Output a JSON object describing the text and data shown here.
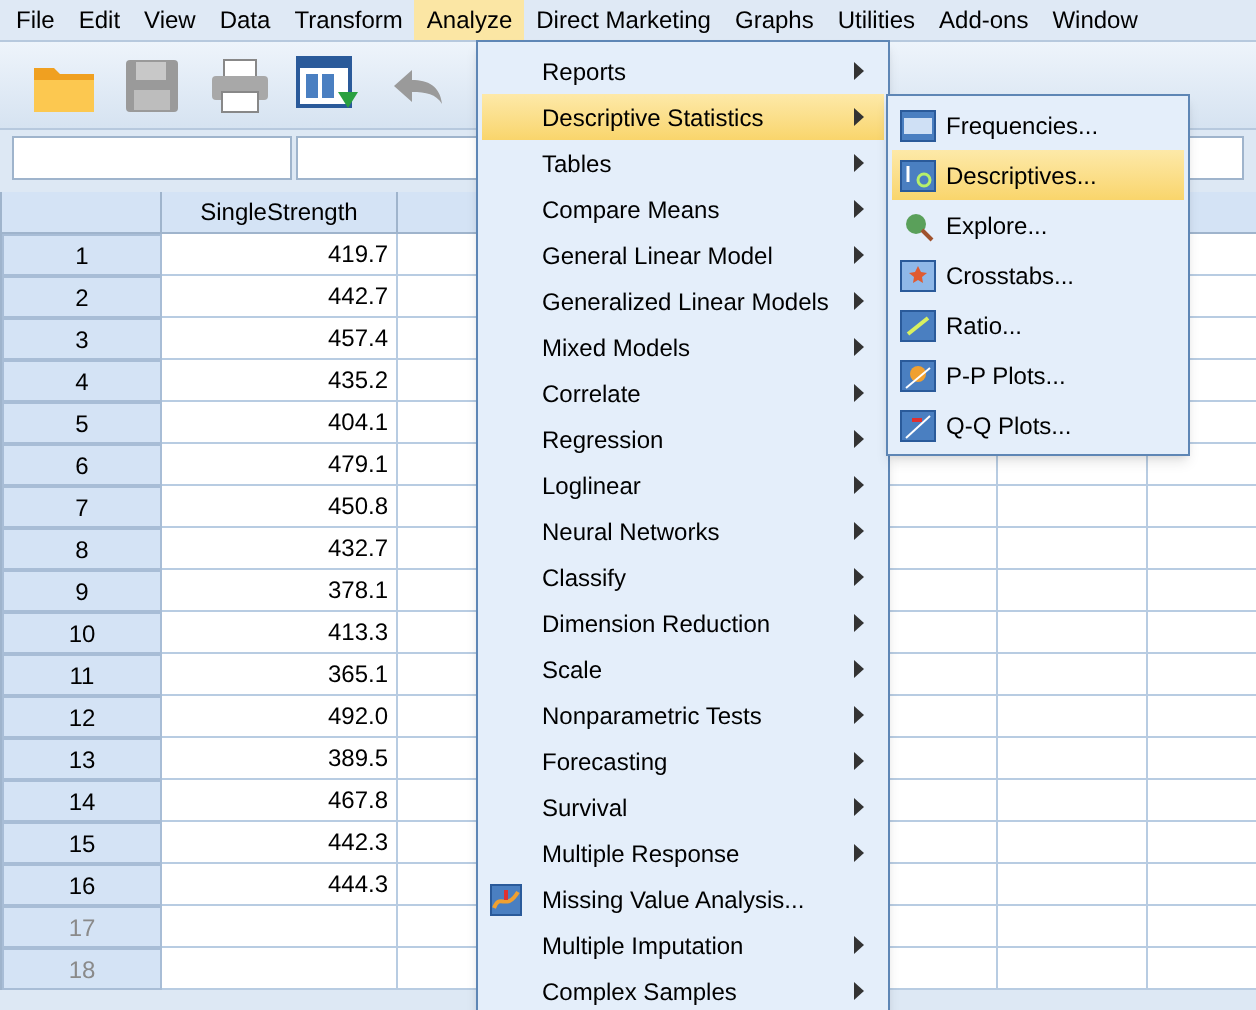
{
  "menu_bar": [
    {
      "label": "File",
      "selected": false
    },
    {
      "label": "Edit",
      "selected": false
    },
    {
      "label": "View",
      "selected": false
    },
    {
      "label": "Data",
      "selected": false
    },
    {
      "label": "Transform",
      "selected": false
    },
    {
      "label": "Analyze",
      "selected": true
    },
    {
      "label": "Direct Marketing",
      "selected": false
    },
    {
      "label": "Graphs",
      "selected": false
    },
    {
      "label": "Utilities",
      "selected": false
    },
    {
      "label": "Add-ons",
      "selected": false
    },
    {
      "label": "Window",
      "selected": false
    }
  ],
  "grid": {
    "columns": [
      "SingleStrength"
    ],
    "rows": [
      {
        "number": "1",
        "value": "419.7",
        "disabled": false
      },
      {
        "number": "2",
        "value": "442.7",
        "disabled": false
      },
      {
        "number": "3",
        "value": "457.4",
        "disabled": false
      },
      {
        "number": "4",
        "value": "435.2",
        "disabled": false
      },
      {
        "number": "5",
        "value": "404.1",
        "disabled": false
      },
      {
        "number": "6",
        "value": "479.1",
        "disabled": false
      },
      {
        "number": "7",
        "value": "450.8",
        "disabled": false
      },
      {
        "number": "8",
        "value": "432.7",
        "disabled": false
      },
      {
        "number": "9",
        "value": "378.1",
        "disabled": false
      },
      {
        "number": "10",
        "value": "413.3",
        "disabled": false
      },
      {
        "number": "11",
        "value": "365.1",
        "disabled": false
      },
      {
        "number": "12",
        "value": "492.0",
        "disabled": false
      },
      {
        "number": "13",
        "value": "389.5",
        "disabled": false
      },
      {
        "number": "14",
        "value": "467.8",
        "disabled": false
      },
      {
        "number": "15",
        "value": "442.3",
        "disabled": false
      },
      {
        "number": "16",
        "value": "444.3",
        "disabled": false
      },
      {
        "number": "17",
        "disabled": true
      },
      {
        "number": "18",
        "disabled": true
      }
    ]
  },
  "analyze_menu": {
    "items": [
      {
        "label": "Reports",
        "kind": "submenu",
        "selected": false
      },
      {
        "label": "Descriptive Statistics",
        "kind": "submenu",
        "selected": true
      },
      {
        "label": "Tables",
        "kind": "submenu",
        "selected": false
      },
      {
        "label": "Compare Means",
        "kind": "submenu",
        "selected": false
      },
      {
        "label": "General Linear Model",
        "kind": "submenu",
        "selected": false
      },
      {
        "label": "Generalized Linear Models",
        "kind": "submenu",
        "selected": false
      },
      {
        "label": "Mixed Models",
        "kind": "submenu",
        "selected": false
      },
      {
        "label": "Correlate",
        "kind": "submenu",
        "selected": false
      },
      {
        "label": "Regression",
        "kind": "submenu",
        "selected": false
      },
      {
        "label": "Loglinear",
        "kind": "submenu",
        "selected": false
      },
      {
        "label": "Neural Networks",
        "kind": "submenu",
        "selected": false
      },
      {
        "label": "Classify",
        "kind": "submenu",
        "selected": false
      },
      {
        "label": "Dimension Reduction",
        "kind": "submenu",
        "selected": false
      },
      {
        "label": "Scale",
        "kind": "submenu",
        "selected": false
      },
      {
        "label": "Nonparametric Tests",
        "kind": "submenu",
        "selected": false
      },
      {
        "label": "Forecasting",
        "kind": "submenu",
        "selected": false
      },
      {
        "label": "Survival",
        "kind": "submenu",
        "selected": false
      },
      {
        "label": "Multiple Response",
        "kind": "submenu",
        "selected": false
      },
      {
        "label": "Missing Value Analysis...",
        "kind": "command",
        "selected": false
      },
      {
        "label": "Multiple Imputation",
        "kind": "submenu",
        "selected": false
      },
      {
        "label": "Complex Samples",
        "kind": "submenu",
        "selected": false
      }
    ]
  },
  "descriptive_submenu": {
    "items": [
      {
        "label": "Frequencies...",
        "selected": false
      },
      {
        "label": "Descriptives...",
        "selected": true
      },
      {
        "label": "Explore...",
        "selected": false
      },
      {
        "label": "Crosstabs...",
        "selected": false
      },
      {
        "label": "Ratio...",
        "selected": false
      },
      {
        "label": "P-P Plots...",
        "selected": false
      },
      {
        "label": "Q-Q Plots...",
        "selected": false
      }
    ]
  }
}
